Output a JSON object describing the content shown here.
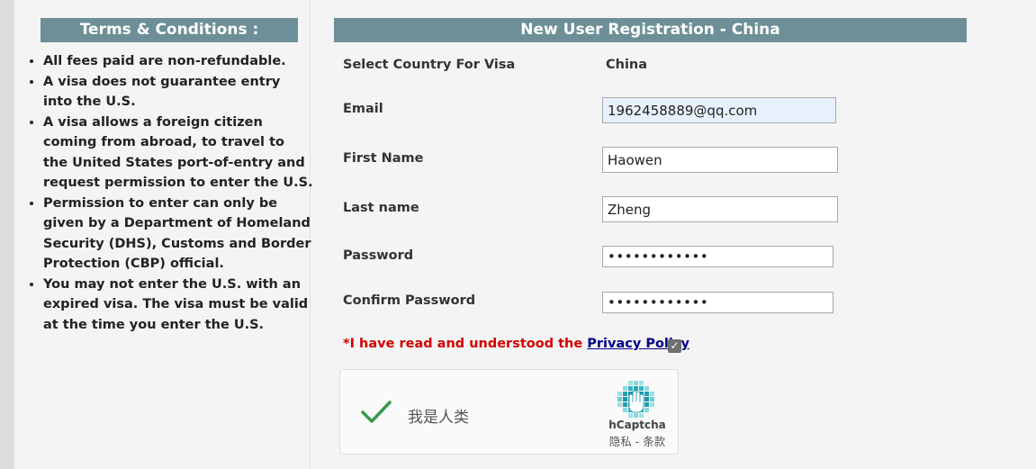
{
  "terms": {
    "title": "Terms & Conditions :",
    "items": [
      "All fees paid are non-refundable.",
      "A visa does not guarantee entry into the U.S.",
      "A visa allows a foreign citizen coming from abroad, to travel to the United States port-of-entry and request permission to enter the U.S.",
      "Permission to enter can only be given by a Department of Homeland Security (DHS), Customs and Border Protection (CBP) official.",
      "You may not enter the U.S. with an expired visa. The visa must be valid at the time you enter the U.S."
    ]
  },
  "registration": {
    "title": "New User Registration - China",
    "country_label": "Select Country For Visa",
    "country_value": "China",
    "email_label": "Email",
    "email_value": "1962458889@qq.com",
    "first_name_label": "First Name",
    "first_name_value": "Haowen",
    "last_name_label": "Last name",
    "last_name_value": "Zheng",
    "password_label": "Password",
    "password_value": "••••••••••••",
    "confirm_password_label": "Confirm Password",
    "confirm_password_value": "••••••••••••",
    "policy_text": "*I have read and understood the ",
    "policy_link": "Privacy Policy",
    "policy_checked": true
  },
  "captcha": {
    "label": "我是人类",
    "brand": "hCaptcha",
    "links": "隐私 - 条款",
    "checked": true
  },
  "colors": {
    "header_bg": "#6d8f97",
    "policy_red": "#d40000",
    "check_green": "#3a9a4a"
  }
}
